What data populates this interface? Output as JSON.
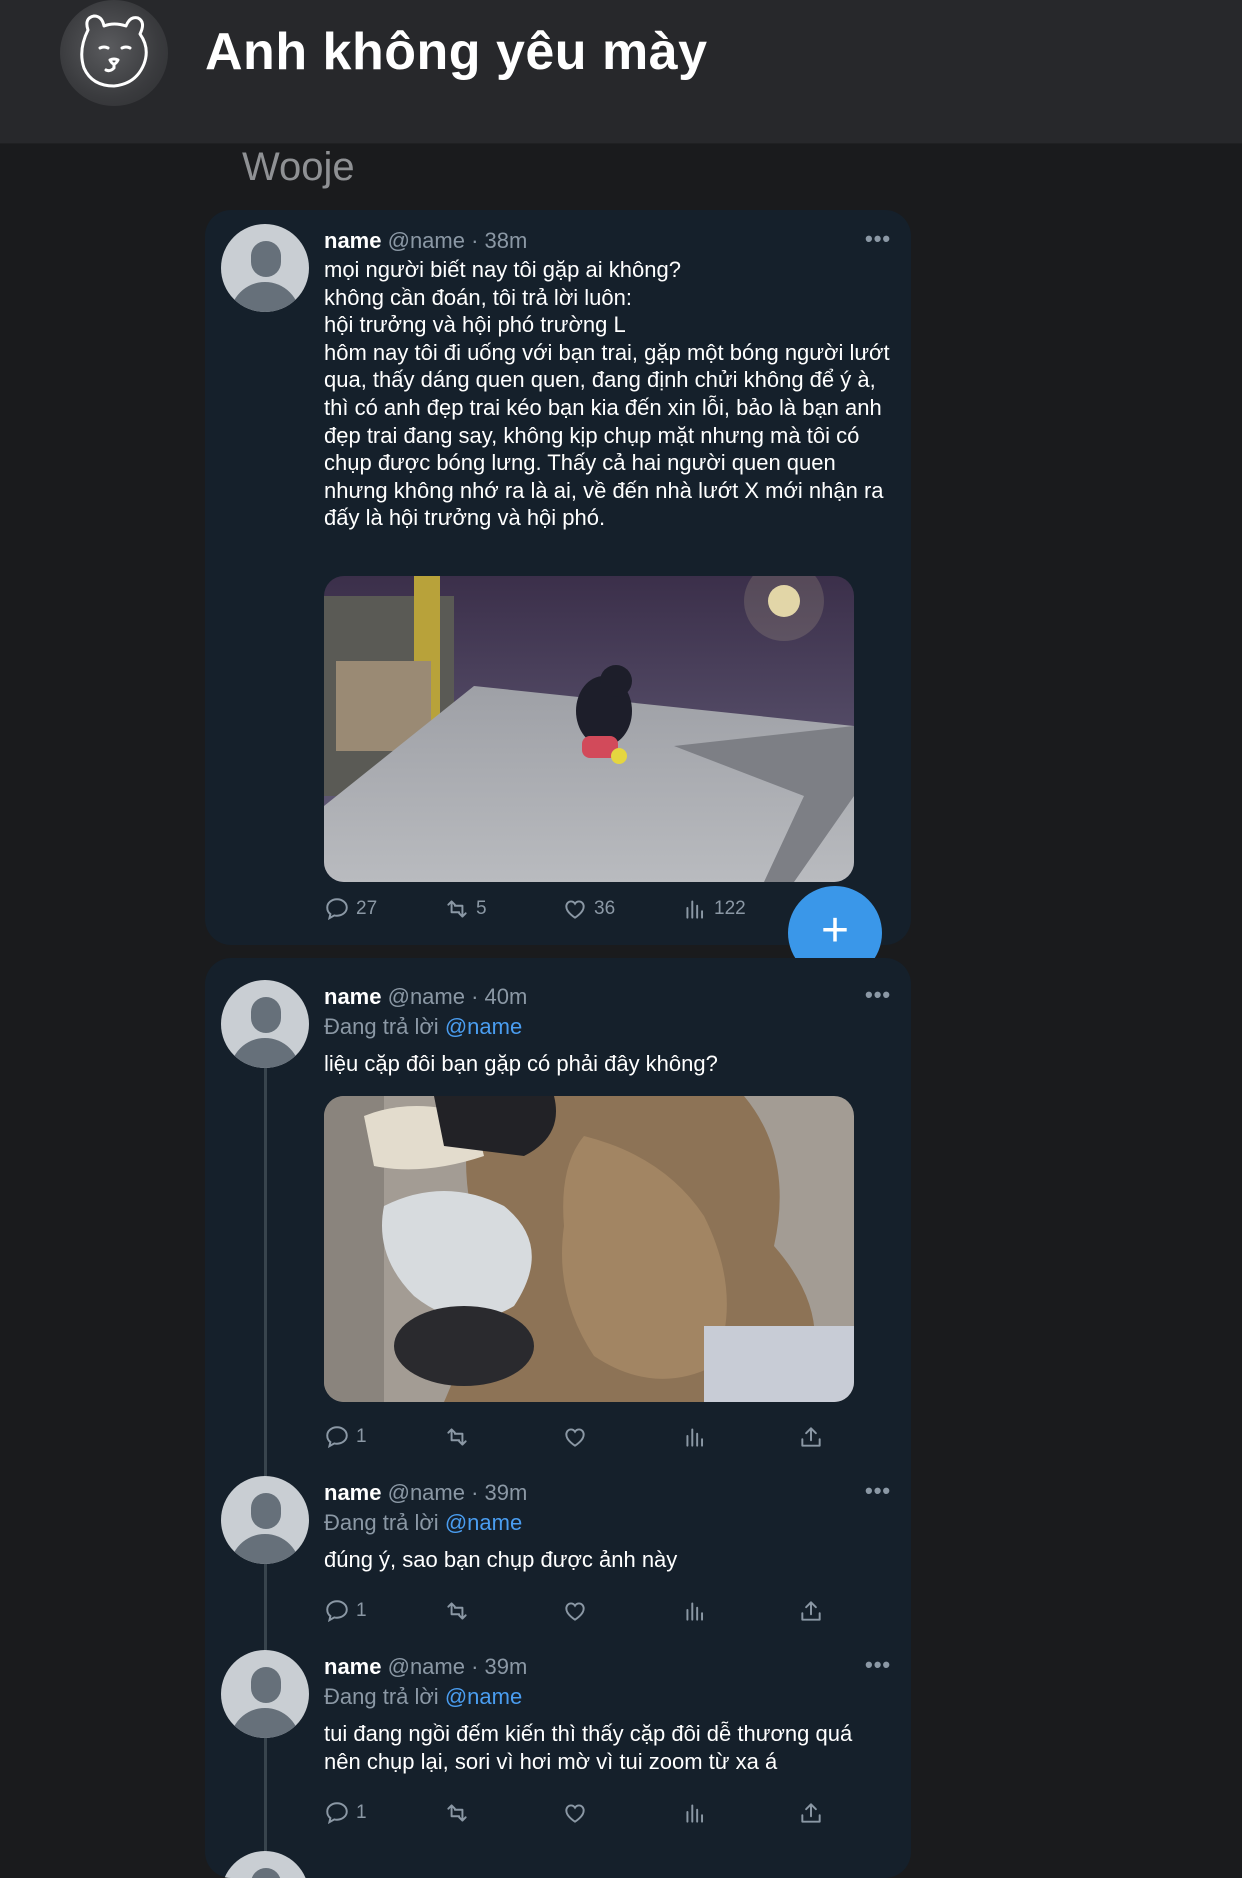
{
  "header": {
    "title": "Anh không yêu mày",
    "avatar_icon": "bear-avatar-icon"
  },
  "section_label": "Wooje",
  "tweets": [
    {
      "name": "name",
      "handle_time": "@name · 38m",
      "more": "•••",
      "text": "mọi người biết nay tôi gặp ai không?\nkhông cần đoán, tôi trả lời luôn:\nhội trưởng và hội phó trường L\nhôm nay tôi đi uống với bạn trai, gặp một bóng người lướt qua, thấy dáng quen quen, đang định chửi không để ý à, thì có anh đẹp trai kéo bạn kia đến xin lỗi, bảo là bạn anh đẹp trai đang say, không kịp chụp mặt nhưng mà tôi có chụp được bóng lưng. Thấy cả hai người quen quen nhưng không nhớ ra là ai, về đến nhà lướt X mới nhận ra đấy là hội trưởng và hội phó.",
      "counts": {
        "replies": "27",
        "retweets": "5",
        "likes": "36",
        "views": "122"
      }
    },
    {
      "name": "name",
      "handle_time": "@name · 40m",
      "more": "•••",
      "reply_prefix": "Đang trả lời",
      "reply_handle": "@name",
      "text": "liệu cặp đôi bạn gặp có phải đây không?",
      "counts": {
        "replies": "1"
      }
    },
    {
      "name": "name",
      "handle_time": "@name · 39m",
      "more": "•••",
      "reply_prefix": "Đang trả lời",
      "reply_handle": "@name",
      "text": "đúng ý, sao bạn chụp được ảnh này",
      "counts": {
        "replies": "1"
      }
    },
    {
      "name": "name",
      "handle_time": "@name · 39m",
      "more": "•••",
      "reply_prefix": "Đang trả lời",
      "reply_handle": "@name",
      "text": "tui đang ngồi đếm kiến thì thấy cặp đôi dễ thương quá nên chụp lại, sori vì hơi mờ vì tui zoom từ xa á",
      "counts": {
        "replies": "1"
      }
    }
  ],
  "fab_label": "+",
  "colors": {
    "background": "#1a1b1d",
    "card": "#15202b",
    "accent": "#3a97e9",
    "link": "#4a9df0",
    "muted": "#8b98a5"
  }
}
